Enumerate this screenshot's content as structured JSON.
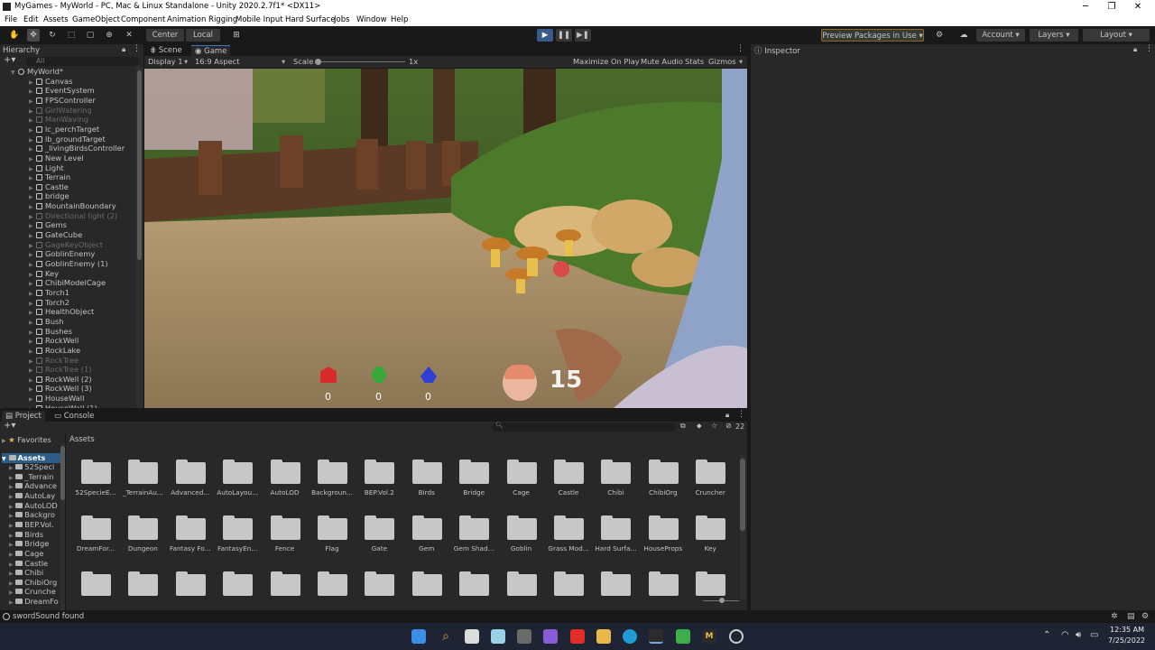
{
  "window": {
    "title": "MyGames - MyWorld - PC, Mac & Linux Standalone - Unity 2020.2.7f1* <DX11>",
    "minimize": "─",
    "maximize": "❐",
    "close": "✕"
  },
  "menu": [
    "File",
    "Edit",
    "Assets",
    "GameObject",
    "Component",
    "Animation Rigging",
    "Mobile Input",
    "Hard Surface",
    "Jobs",
    "Window",
    "Help"
  ],
  "toolbar": {
    "center": "Center",
    "local": "Local",
    "preview_packages": "Preview Packages in Use",
    "account": "Account",
    "layers": "Layers",
    "layout": "Layout"
  },
  "hierarchy": {
    "tab": "Hierarchy",
    "search_placeholder": "All",
    "scene": "MyWorld*",
    "items": [
      {
        "label": "Canvas",
        "dim": false
      },
      {
        "label": "EventSystem",
        "dim": false
      },
      {
        "label": "FPSController",
        "dim": false
      },
      {
        "label": "GirlWatering",
        "dim": true
      },
      {
        "label": "ManWaving",
        "dim": true
      },
      {
        "label": "lc_perchTarget",
        "dim": false
      },
      {
        "label": "lb_groundTarget",
        "dim": false
      },
      {
        "label": "_livingBirdsController",
        "dim": false
      },
      {
        "label": "New Level",
        "dim": false
      },
      {
        "label": "Light",
        "dim": false
      },
      {
        "label": "Terrain",
        "dim": false
      },
      {
        "label": "Castle",
        "dim": false
      },
      {
        "label": "bridge",
        "dim": false
      },
      {
        "label": "MountainBoundary",
        "dim": false
      },
      {
        "label": "Directional light (2)",
        "dim": true
      },
      {
        "label": "Gems",
        "dim": false
      },
      {
        "label": "GateCube",
        "dim": false
      },
      {
        "label": "GageKeyObject",
        "dim": true
      },
      {
        "label": "GoblinEnemy",
        "dim": false
      },
      {
        "label": "GoblinEnemy (1)",
        "dim": false
      },
      {
        "label": "Key",
        "dim": false
      },
      {
        "label": "ChibiModelCage",
        "dim": false
      },
      {
        "label": "Torch1",
        "dim": false
      },
      {
        "label": "Torch2",
        "dim": false
      },
      {
        "label": "HealthObject",
        "dim": false
      },
      {
        "label": "Bush",
        "dim": false
      },
      {
        "label": "Bushes",
        "dim": false
      },
      {
        "label": "RockWell",
        "dim": false
      },
      {
        "label": "RockLake",
        "dim": false
      },
      {
        "label": "RockTree",
        "dim": true
      },
      {
        "label": "RockTree (1)",
        "dim": true
      },
      {
        "label": "RockWell (2)",
        "dim": false
      },
      {
        "label": "RockWell (3)",
        "dim": false
      },
      {
        "label": "HouseWall",
        "dim": false
      },
      {
        "label": "HouseWall (1)",
        "dim": false
      }
    ]
  },
  "views": {
    "scene_tab": "Scene",
    "game_tab": "Game",
    "display": "Display 1",
    "aspect": "16:9 Aspect",
    "scale_label": "Scale",
    "scale_value": "1x",
    "maximize_on_play": "Maximize On Play",
    "mute_audio": "Mute Audio",
    "stats": "Stats",
    "gizmos": "Gizmos"
  },
  "game_hud": {
    "gems": [
      {
        "color": "#d92b2b",
        "count": "0"
      },
      {
        "color": "#39a83a",
        "count": "0"
      },
      {
        "color": "#2e3fd6",
        "count": "0"
      }
    ],
    "health": "15"
  },
  "inspector": {
    "tab": "Inspector"
  },
  "project": {
    "project_tab": "Project",
    "console_tab": "Console",
    "favorites": "Favorites",
    "assets_root": "Assets",
    "breadcrumb": "Assets",
    "hidden_count": "22",
    "tree": [
      "52Speci",
      "_Terrain",
      "Advance",
      "AutoLay",
      "AutoLOD",
      "Backgro",
      "BEP.Vol.",
      "Birds",
      "Bridge",
      "Cage",
      "Castle",
      "Chibi",
      "ChibiOrg",
      "Crunche",
      "DreamFo"
    ],
    "folders": [
      "52SpecieE...",
      "_TerrainAu...",
      "Advanced...",
      "AutoLayou...",
      "AutoLOD",
      "Backgroun...",
      "BEP.Vol.2",
      "Birds",
      "Bridge",
      "Cage",
      "Castle",
      "Chibi",
      "ChibiOrg",
      "Cruncher",
      "DreamFor...",
      "Dungeon",
      "Fantasy Fo...",
      "FantasyEn...",
      "Fence",
      "Flag",
      "Gate",
      "Gem",
      "Gem Shad...",
      "Goblin",
      "Grass Mod...",
      "Hard Surfa...",
      "HouseProps",
      "Key",
      "",
      "",
      "",
      "",
      "",
      "",
      "",
      "",
      "",
      "",
      "",
      "",
      "",
      ""
    ]
  },
  "status": {
    "message": "swordSound found"
  },
  "taskbar": {
    "time": "12:35 AM",
    "date": "7/25/2022"
  }
}
